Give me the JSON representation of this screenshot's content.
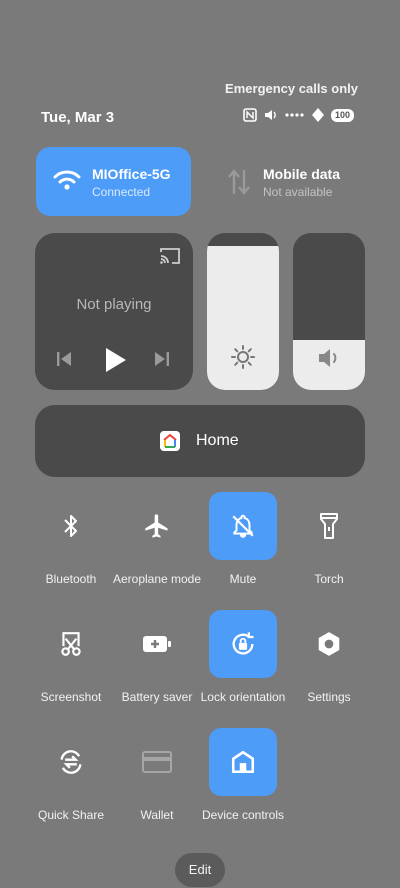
{
  "status": {
    "emergency": "Emergency calls only",
    "date": "Tue, Mar 3",
    "battery": "100"
  },
  "wifi": {
    "name": "MIOffice-5G",
    "status": "Connected"
  },
  "mobile": {
    "title": "Mobile data",
    "status": "Not available"
  },
  "media": {
    "status": "Not playing"
  },
  "sliders": {
    "brightness_level": 0.92,
    "volume_level": 0.32
  },
  "home": {
    "label": "Home"
  },
  "tiles": [
    {
      "label": "Bluetooth",
      "icon": "bluetooth-icon",
      "active": false
    },
    {
      "label": "Aeroplane mode",
      "icon": "airplane-icon",
      "active": false
    },
    {
      "label": "Mute",
      "icon": "bell-off-icon",
      "active": true
    },
    {
      "label": "Torch",
      "icon": "flashlight-icon",
      "active": false
    },
    {
      "label": "Screenshot",
      "icon": "scissors-icon",
      "active": false
    },
    {
      "label": "Battery saver",
      "icon": "battery-plus-icon",
      "active": false
    },
    {
      "label": "Lock orientation",
      "icon": "rotation-lock-icon",
      "active": true
    },
    {
      "label": "Settings",
      "icon": "gear-icon",
      "active": false
    },
    {
      "label": "Quick Share",
      "icon": "quick-share-icon",
      "active": false
    },
    {
      "label": "Wallet",
      "icon": "wallet-icon",
      "active": false
    },
    {
      "label": "Device controls",
      "icon": "home-icon",
      "active": true
    }
  ],
  "edit_label": "Edit",
  "colors": {
    "accent": "#4d9cf8",
    "background": "#7a7a7a",
    "panel": "#4a4a4a"
  }
}
